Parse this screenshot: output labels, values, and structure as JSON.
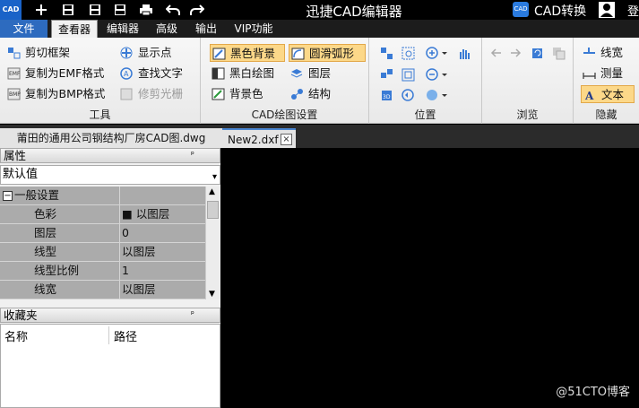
{
  "titlebar": {
    "logo": "CAD",
    "title": "迅捷CAD编辑器",
    "convert_label": "CAD转换",
    "convert_logo": "CAD",
    "extra": "登",
    "quick_icons": [
      "menu-icon",
      "new-icon",
      "save-icon",
      "save-as-icon",
      "print-icon",
      "undo-icon",
      "redo-icon"
    ]
  },
  "menu": {
    "file": "文件",
    "viewer": "查看器",
    "editor": "编辑器",
    "advanced": "高级",
    "output": "输出",
    "vip": "VIP功能"
  },
  "ribbon": {
    "tools": {
      "label": "工具",
      "clip_frame": "剪切框架",
      "copy_emf": "复制为EMF格式",
      "copy_bmp": "复制为BMP格式",
      "show_points": "显示点",
      "find_text": "查找文字",
      "trim_raster": "修剪光栅"
    },
    "cad_settings": {
      "label": "CAD绘图设置",
      "black_bg": "黑色背景",
      "smooth_arc": "圆滑弧形",
      "bw_drawing": "黑白绘图",
      "layers": "图层",
      "bg_color": "背景色",
      "structure": "结构"
    },
    "position": {
      "label": "位置"
    },
    "browse": {
      "label": "浏览"
    },
    "hide": {
      "label": "隐藏",
      "line_width": "线宽",
      "measure": "测量",
      "text": "文本"
    }
  },
  "doctabs": {
    "tab1": "莆田的通用公司钢结构厂房CAD图.dwg",
    "tab2": "New2.dxf",
    "close": "×"
  },
  "properties": {
    "header": "属性",
    "pin": "ᵖ",
    "select_value": "默认值",
    "category": "一般设置",
    "collapse": "−",
    "rows": [
      {
        "name": "色彩",
        "value": "■ 以图层"
      },
      {
        "name": "图层",
        "value": "0"
      },
      {
        "name": "线型",
        "value": "以图层"
      },
      {
        "name": "线型比例",
        "value": "1"
      },
      {
        "name": "线宽",
        "value": "以图层"
      }
    ]
  },
  "favorites": {
    "header": "收藏夹",
    "col_name": "名称",
    "col_path": "路径"
  },
  "watermark": "@51CTO博客",
  "colors": {
    "title_bg": "#000000",
    "menu_file_bg": "#2d6bbf",
    "ribbon_active": "#fcd889",
    "canvas_bg": "#000000"
  }
}
